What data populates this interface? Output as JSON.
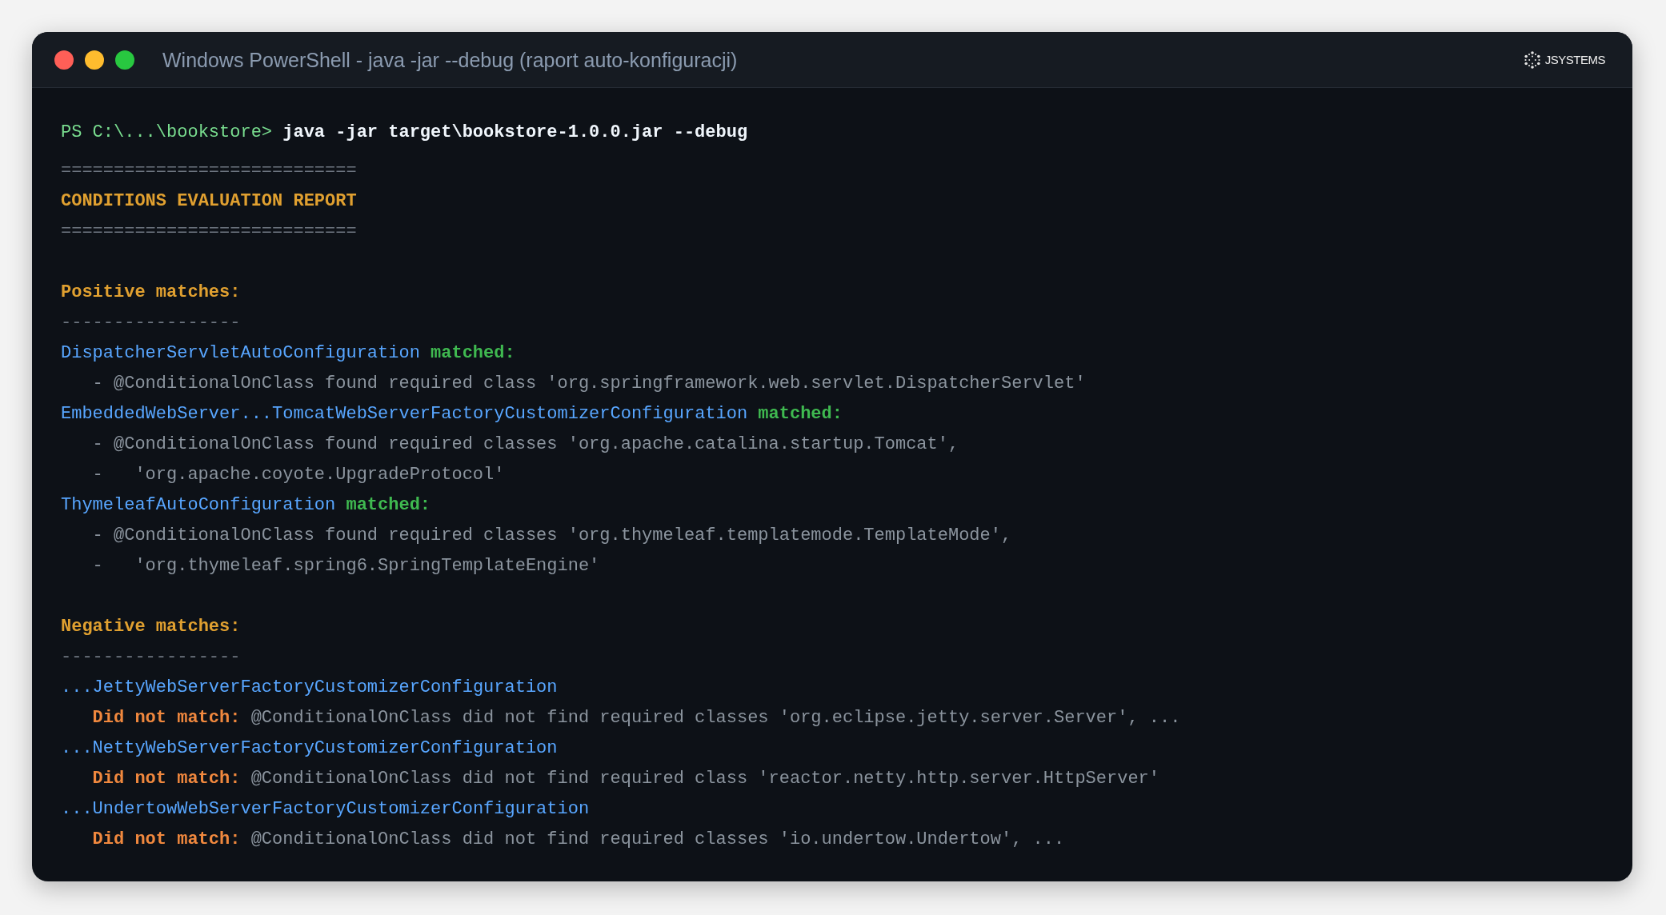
{
  "window": {
    "title": "Windows PowerShell - java -jar --debug (raport auto-konfiguracji)",
    "logo": {
      "text": "JSYSTEMS"
    }
  },
  "terminal": {
    "prompt": "PS C:\\...\\bookstore>",
    "command": "java -jar target\\bookstore-1.0.0.jar --debug",
    "report": {
      "rule_top": "============================",
      "title": "CONDITIONS EVALUATION REPORT",
      "rule_bottom": "============================"
    },
    "sections": [
      {
        "kind": "positive",
        "heading": "Positive matches:",
        "underline": "-----------------",
        "entries": [
          {
            "name": "DispatcherServletAutoConfiguration",
            "status": "matched:",
            "details": [
              "- @ConditionalOnClass found required class 'org.springframework.web.servlet.DispatcherServlet'"
            ]
          },
          {
            "name": "EmbeddedWebServer...TomcatWebServerFactoryCustomizerConfiguration",
            "status": "matched:",
            "details": [
              "- @ConditionalOnClass found required classes 'org.apache.catalina.startup.Tomcat',",
              "-   'org.apache.coyote.UpgradeProtocol'"
            ]
          },
          {
            "name": "ThymeleafAutoConfiguration",
            "status": "matched:",
            "details": [
              "- @ConditionalOnClass found required classes 'org.thymeleaf.templatemode.TemplateMode',",
              "-   'org.thymeleaf.spring6.SpringTemplateEngine'"
            ]
          }
        ]
      },
      {
        "kind": "negative",
        "heading": "Negative matches:",
        "underline": "-----------------",
        "entries": [
          {
            "name": "...JettyWebServerFactoryCustomizerConfiguration",
            "status": "Did not match:",
            "details": [
              "@ConditionalOnClass did not find required classes 'org.eclipse.jetty.server.Server', ..."
            ]
          },
          {
            "name": "...NettyWebServerFactoryCustomizerConfiguration",
            "status": "Did not match:",
            "details": [
              "@ConditionalOnClass did not find required class 'reactor.netty.http.server.HttpServer'"
            ]
          },
          {
            "name": "...UndertowWebServerFactoryCustomizerConfiguration",
            "status": "Did not match:",
            "details": [
              "@ConditionalOnClass did not find required classes 'io.undertow.Undertow', ..."
            ]
          }
        ]
      }
    ]
  }
}
